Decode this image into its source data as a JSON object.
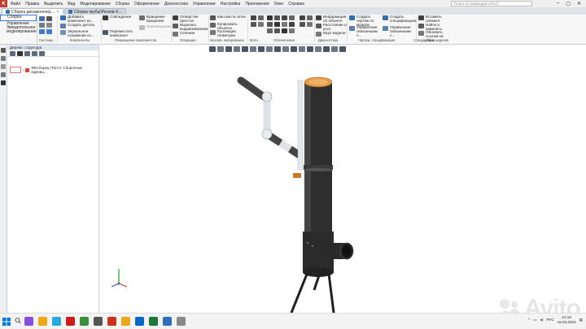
{
  "menu": [
    "Файл",
    "Правка",
    "Выделить",
    "Вид",
    "Моделирование",
    "Сборка",
    "Оформление",
    "Диагностика",
    "Управление",
    "Настройка",
    "Приложения",
    "Окно",
    "Справка"
  ],
  "search": {
    "placeholder": "Поиск по командам (Alt+/)"
  },
  "tabs": [
    {
      "label": "Сборка динамогенер…",
      "active": true
    },
    {
      "label": "Сборка трубы\\Ресков 4…",
      "active": false
    }
  ],
  "left_tabs": [
    "Сборка",
    "Управление",
    "Звердотельное моделирование"
  ],
  "ribbon": {
    "system": "Система",
    "components": {
      "add": "Добавить компонент из…",
      "create": "Создать деталь",
      "mirror": "Зеркальное отражение ко…",
      "label": "Компоненты"
    },
    "placement": {
      "coincidence": "Совпадение",
      "move": "Переместить компонент",
      "rotate": "Вращение-вращение",
      "disp": "Перемещение",
      "label": "Размещение компонентов"
    },
    "operations": {
      "hole": "Отверстие простое",
      "cut": "Вырезать выдавливанием",
      "section": "Сечение",
      "label": "Операции"
    },
    "mass": {
      "mass": "Массив по сетке",
      "copy": "Копировать объекты",
      "collection": "Коллекция геометрии",
      "label": "Массив, копирование"
    },
    "aux": {
      "label": "Вспо…"
    },
    "designations": {
      "label": "Обозначения"
    },
    "diagnostics": {
      "info": "Информация об объекте",
      "distance": "Расстояние и угол",
      "mcx": "МЦХ модели",
      "label": "Диагностика"
    },
    "drawing": {
      "create": "Создать чертеж по модели",
      "manage": "Управление связанными ч…",
      "spec": "Создать спецификацию…",
      "manage2": "Управление связанными с…",
      "label": "Чертеж, спецификация"
    },
    "standard": {
      "insert": "Вставить элемент",
      "find": "Найти и заменить",
      "update": "Обновить ссылки на обра…",
      "label": "Стандартные изделия"
    }
  },
  "panel": {
    "title": "Дерево: структура",
    "tree_item": "ФКСборка (Тел-0, Сборочных единиц…"
  },
  "watermark": "Avito",
  "tray": {
    "lang": "РУС",
    "time": "21:13",
    "date": "16.03.2022"
  },
  "colors": {
    "brand": "#c0392b",
    "accent": "#3c7dd1",
    "pipe": "#2e2e2e",
    "cap": "#e39a4a"
  }
}
